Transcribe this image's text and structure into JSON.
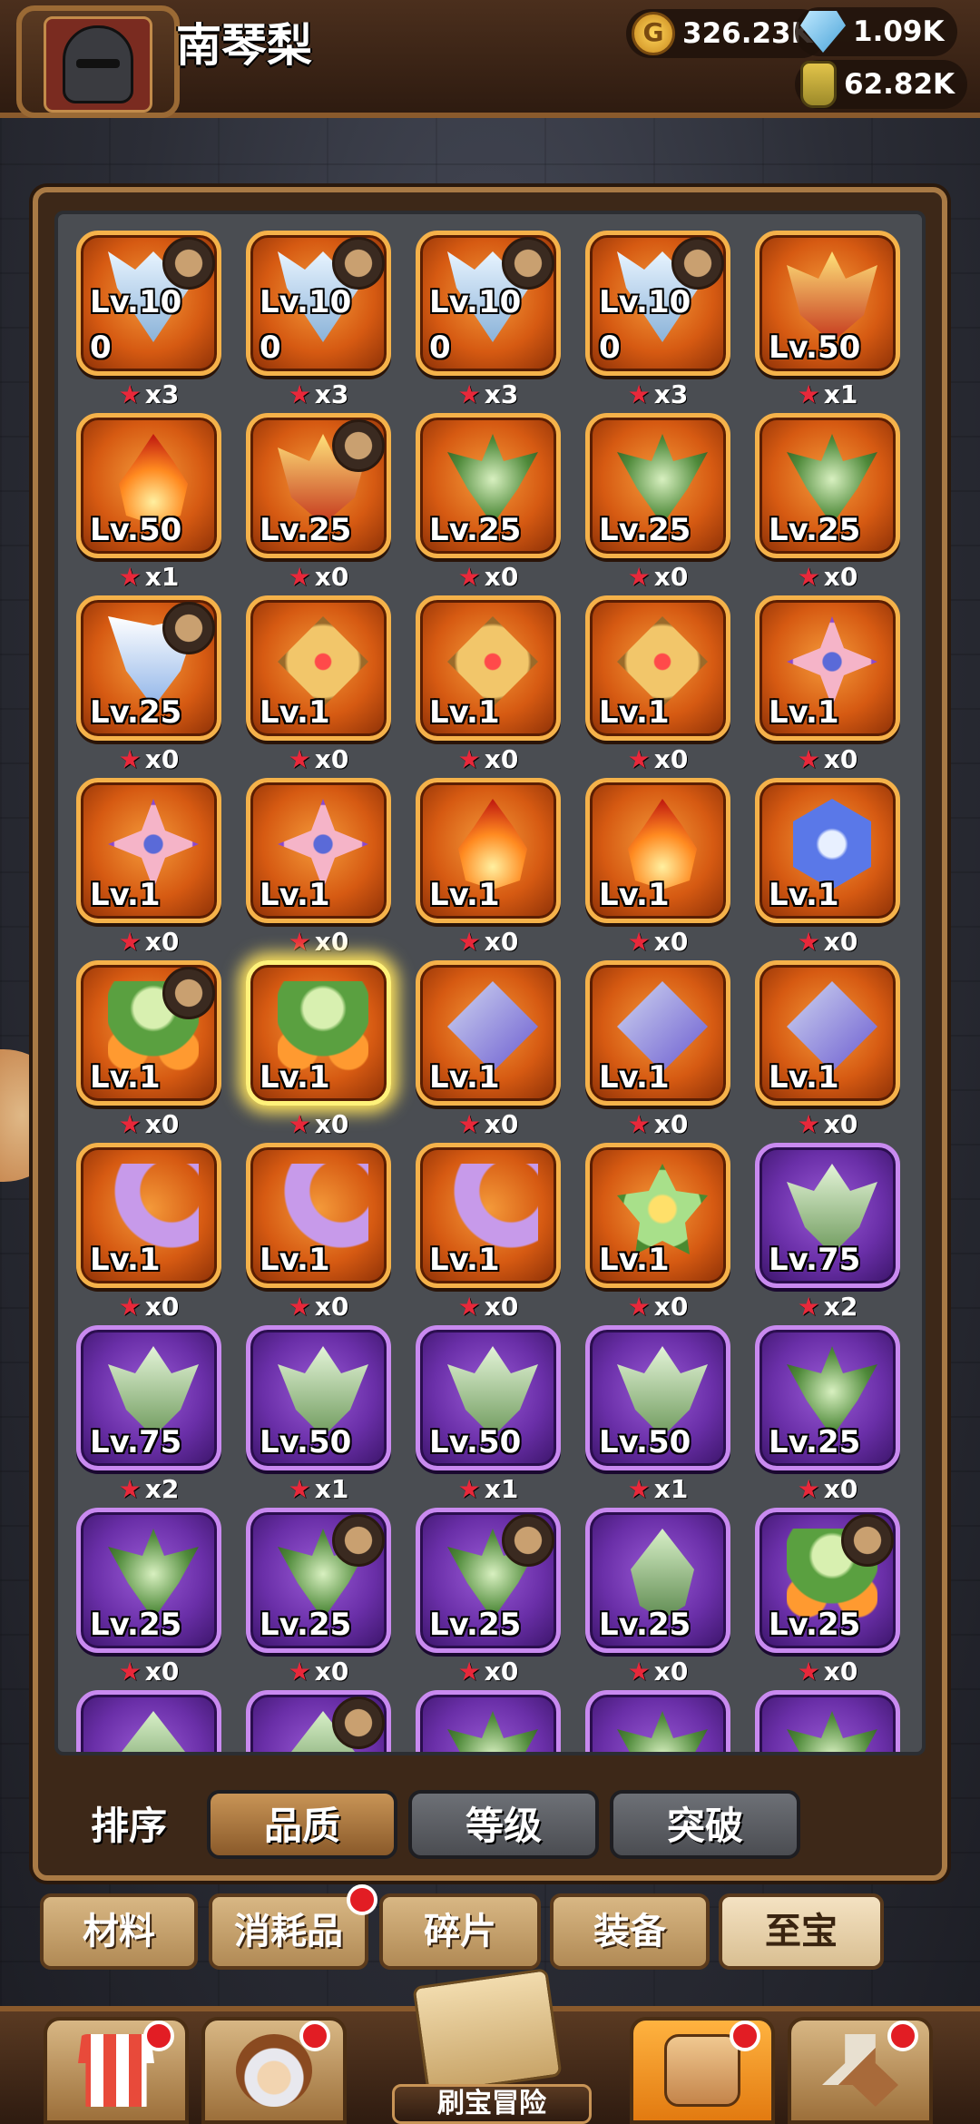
{
  "player": {
    "name": "南琴梨"
  },
  "resources": {
    "gold": "326.23K",
    "gems": "1.09K",
    "potion": "62.82K"
  },
  "relics": [
    {
      "level": "Lv.10",
      "extra": "0",
      "count": "x3",
      "rarity": "orange",
      "icon": "wings",
      "hero": true
    },
    {
      "level": "Lv.10",
      "extra": "0",
      "count": "x3",
      "rarity": "orange",
      "icon": "wings",
      "hero": true
    },
    {
      "level": "Lv.10",
      "extra": "0",
      "count": "x3",
      "rarity": "orange",
      "icon": "wings",
      "hero": true
    },
    {
      "level": "Lv.10",
      "extra": "0",
      "count": "x3",
      "rarity": "orange",
      "icon": "wings",
      "hero": true
    },
    {
      "level": "Lv.50",
      "extra": "",
      "count": "x1",
      "rarity": "orange",
      "icon": "crown",
      "hero": false
    },
    {
      "level": "Lv.50",
      "extra": "",
      "count": "x1",
      "rarity": "orange",
      "icon": "fire",
      "hero": false
    },
    {
      "level": "Lv.25",
      "extra": "",
      "count": "x0",
      "rarity": "orange",
      "icon": "crown",
      "hero": true
    },
    {
      "level": "Lv.25",
      "extra": "",
      "count": "x0",
      "rarity": "orange",
      "icon": "thorn",
      "hero": false
    },
    {
      "level": "Lv.25",
      "extra": "",
      "count": "x0",
      "rarity": "orange",
      "icon": "thorn",
      "hero": false
    },
    {
      "level": "Lv.25",
      "extra": "",
      "count": "x0",
      "rarity": "orange",
      "icon": "thorn",
      "hero": false
    },
    {
      "level": "Lv.25",
      "extra": "",
      "count": "x0",
      "rarity": "orange",
      "icon": "angel",
      "hero": true
    },
    {
      "level": "Lv.1",
      "extra": "",
      "count": "x0",
      "rarity": "orange",
      "icon": "shield",
      "hero": false
    },
    {
      "level": "Lv.1",
      "extra": "",
      "count": "x0",
      "rarity": "orange",
      "icon": "shield",
      "hero": false
    },
    {
      "level": "Lv.1",
      "extra": "",
      "count": "x0",
      "rarity": "orange",
      "icon": "shield",
      "hero": false
    },
    {
      "level": "Lv.1",
      "extra": "",
      "count": "x0",
      "rarity": "orange",
      "icon": "flower",
      "hero": false
    },
    {
      "level": "Lv.1",
      "extra": "",
      "count": "x0",
      "rarity": "orange",
      "icon": "flower",
      "hero": false
    },
    {
      "level": "Lv.1",
      "extra": "",
      "count": "x0",
      "rarity": "orange",
      "icon": "flower",
      "hero": false
    },
    {
      "level": "Lv.1",
      "extra": "",
      "count": "x0",
      "rarity": "orange",
      "icon": "fire",
      "hero": false
    },
    {
      "level": "Lv.1",
      "extra": "",
      "count": "x0",
      "rarity": "orange",
      "icon": "fire",
      "hero": false
    },
    {
      "level": "Lv.1",
      "extra": "",
      "count": "x0",
      "rarity": "orange",
      "icon": "snow",
      "hero": false
    },
    {
      "level": "Lv.1",
      "extra": "",
      "count": "x0",
      "rarity": "orange",
      "icon": "clover",
      "hero": true
    },
    {
      "level": "Lv.1",
      "extra": "",
      "count": "x0",
      "rarity": "orange",
      "icon": "clover",
      "hero": false,
      "selected": true
    },
    {
      "level": "Lv.1",
      "extra": "",
      "count": "x0",
      "rarity": "orange",
      "icon": "spear",
      "hero": false
    },
    {
      "level": "Lv.1",
      "extra": "",
      "count": "x0",
      "rarity": "orange",
      "icon": "spear",
      "hero": false
    },
    {
      "level": "Lv.1",
      "extra": "",
      "count": "x0",
      "rarity": "orange",
      "icon": "spear",
      "hero": false
    },
    {
      "level": "Lv.1",
      "extra": "",
      "count": "x0",
      "rarity": "orange",
      "icon": "moon",
      "hero": false
    },
    {
      "level": "Lv.1",
      "extra": "",
      "count": "x0",
      "rarity": "orange",
      "icon": "moon",
      "hero": false
    },
    {
      "level": "Lv.1",
      "extra": "",
      "count": "x0",
      "rarity": "orange",
      "icon": "moon",
      "hero": false
    },
    {
      "level": "Lv.1",
      "extra": "",
      "count": "x0",
      "rarity": "orange",
      "icon": "lotus",
      "hero": false
    },
    {
      "level": "Lv.75",
      "extra": "",
      "count": "x2",
      "rarity": "purple",
      "icon": "leaf",
      "hero": false
    },
    {
      "level": "Lv.75",
      "extra": "",
      "count": "x2",
      "rarity": "purple",
      "icon": "leaf",
      "hero": false
    },
    {
      "level": "Lv.50",
      "extra": "",
      "count": "x1",
      "rarity": "purple",
      "icon": "leaf",
      "hero": false
    },
    {
      "level": "Lv.50",
      "extra": "",
      "count": "x1",
      "rarity": "purple",
      "icon": "leaf",
      "hero": false
    },
    {
      "level": "Lv.50",
      "extra": "",
      "count": "x1",
      "rarity": "purple",
      "icon": "leaf",
      "hero": false
    },
    {
      "level": "Lv.25",
      "extra": "",
      "count": "x0",
      "rarity": "purple",
      "icon": "thorn",
      "hero": false
    },
    {
      "level": "Lv.25",
      "extra": "",
      "count": "x0",
      "rarity": "purple",
      "icon": "thorn",
      "hero": false
    },
    {
      "level": "Lv.25",
      "extra": "",
      "count": "x0",
      "rarity": "purple",
      "icon": "thorn",
      "hero": true
    },
    {
      "level": "Lv.25",
      "extra": "",
      "count": "x0",
      "rarity": "purple",
      "icon": "thorn",
      "hero": true
    },
    {
      "level": "Lv.25",
      "extra": "",
      "count": "x0",
      "rarity": "purple",
      "icon": "bud",
      "hero": false
    },
    {
      "level": "Lv.25",
      "extra": "",
      "count": "x0",
      "rarity": "purple",
      "icon": "clover",
      "hero": true
    },
    {
      "level": "",
      "extra": "",
      "count": "",
      "rarity": "purple",
      "icon": "bud",
      "hero": false
    },
    {
      "level": "",
      "extra": "",
      "count": "",
      "rarity": "purple",
      "icon": "bud",
      "hero": true
    },
    {
      "level": "",
      "extra": "",
      "count": "",
      "rarity": "purple",
      "icon": "thorn",
      "hero": false
    },
    {
      "level": "",
      "extra": "",
      "count": "",
      "rarity": "purple",
      "icon": "thorn",
      "hero": false
    },
    {
      "level": "",
      "extra": "",
      "count": "",
      "rarity": "purple",
      "icon": "thorn",
      "hero": false
    }
  ],
  "sort": {
    "label": "排序",
    "options": [
      "品质",
      "等级",
      "突破"
    ],
    "active": "品质"
  },
  "categories": [
    {
      "label": "材料",
      "badge": false
    },
    {
      "label": "消耗品",
      "badge": true
    },
    {
      "label": "碎片",
      "badge": false
    },
    {
      "label": "装备",
      "badge": false
    },
    {
      "label": "至宝",
      "badge": false,
      "selected": true
    }
  ],
  "bottom_nav": {
    "adventure_label": "刷宝冒险"
  },
  "colors": {
    "orange_tile": "#d65a12",
    "purple_tile": "#6a2fa8",
    "gold_border": "#f5b24a",
    "badge_red": "#e21d24"
  }
}
